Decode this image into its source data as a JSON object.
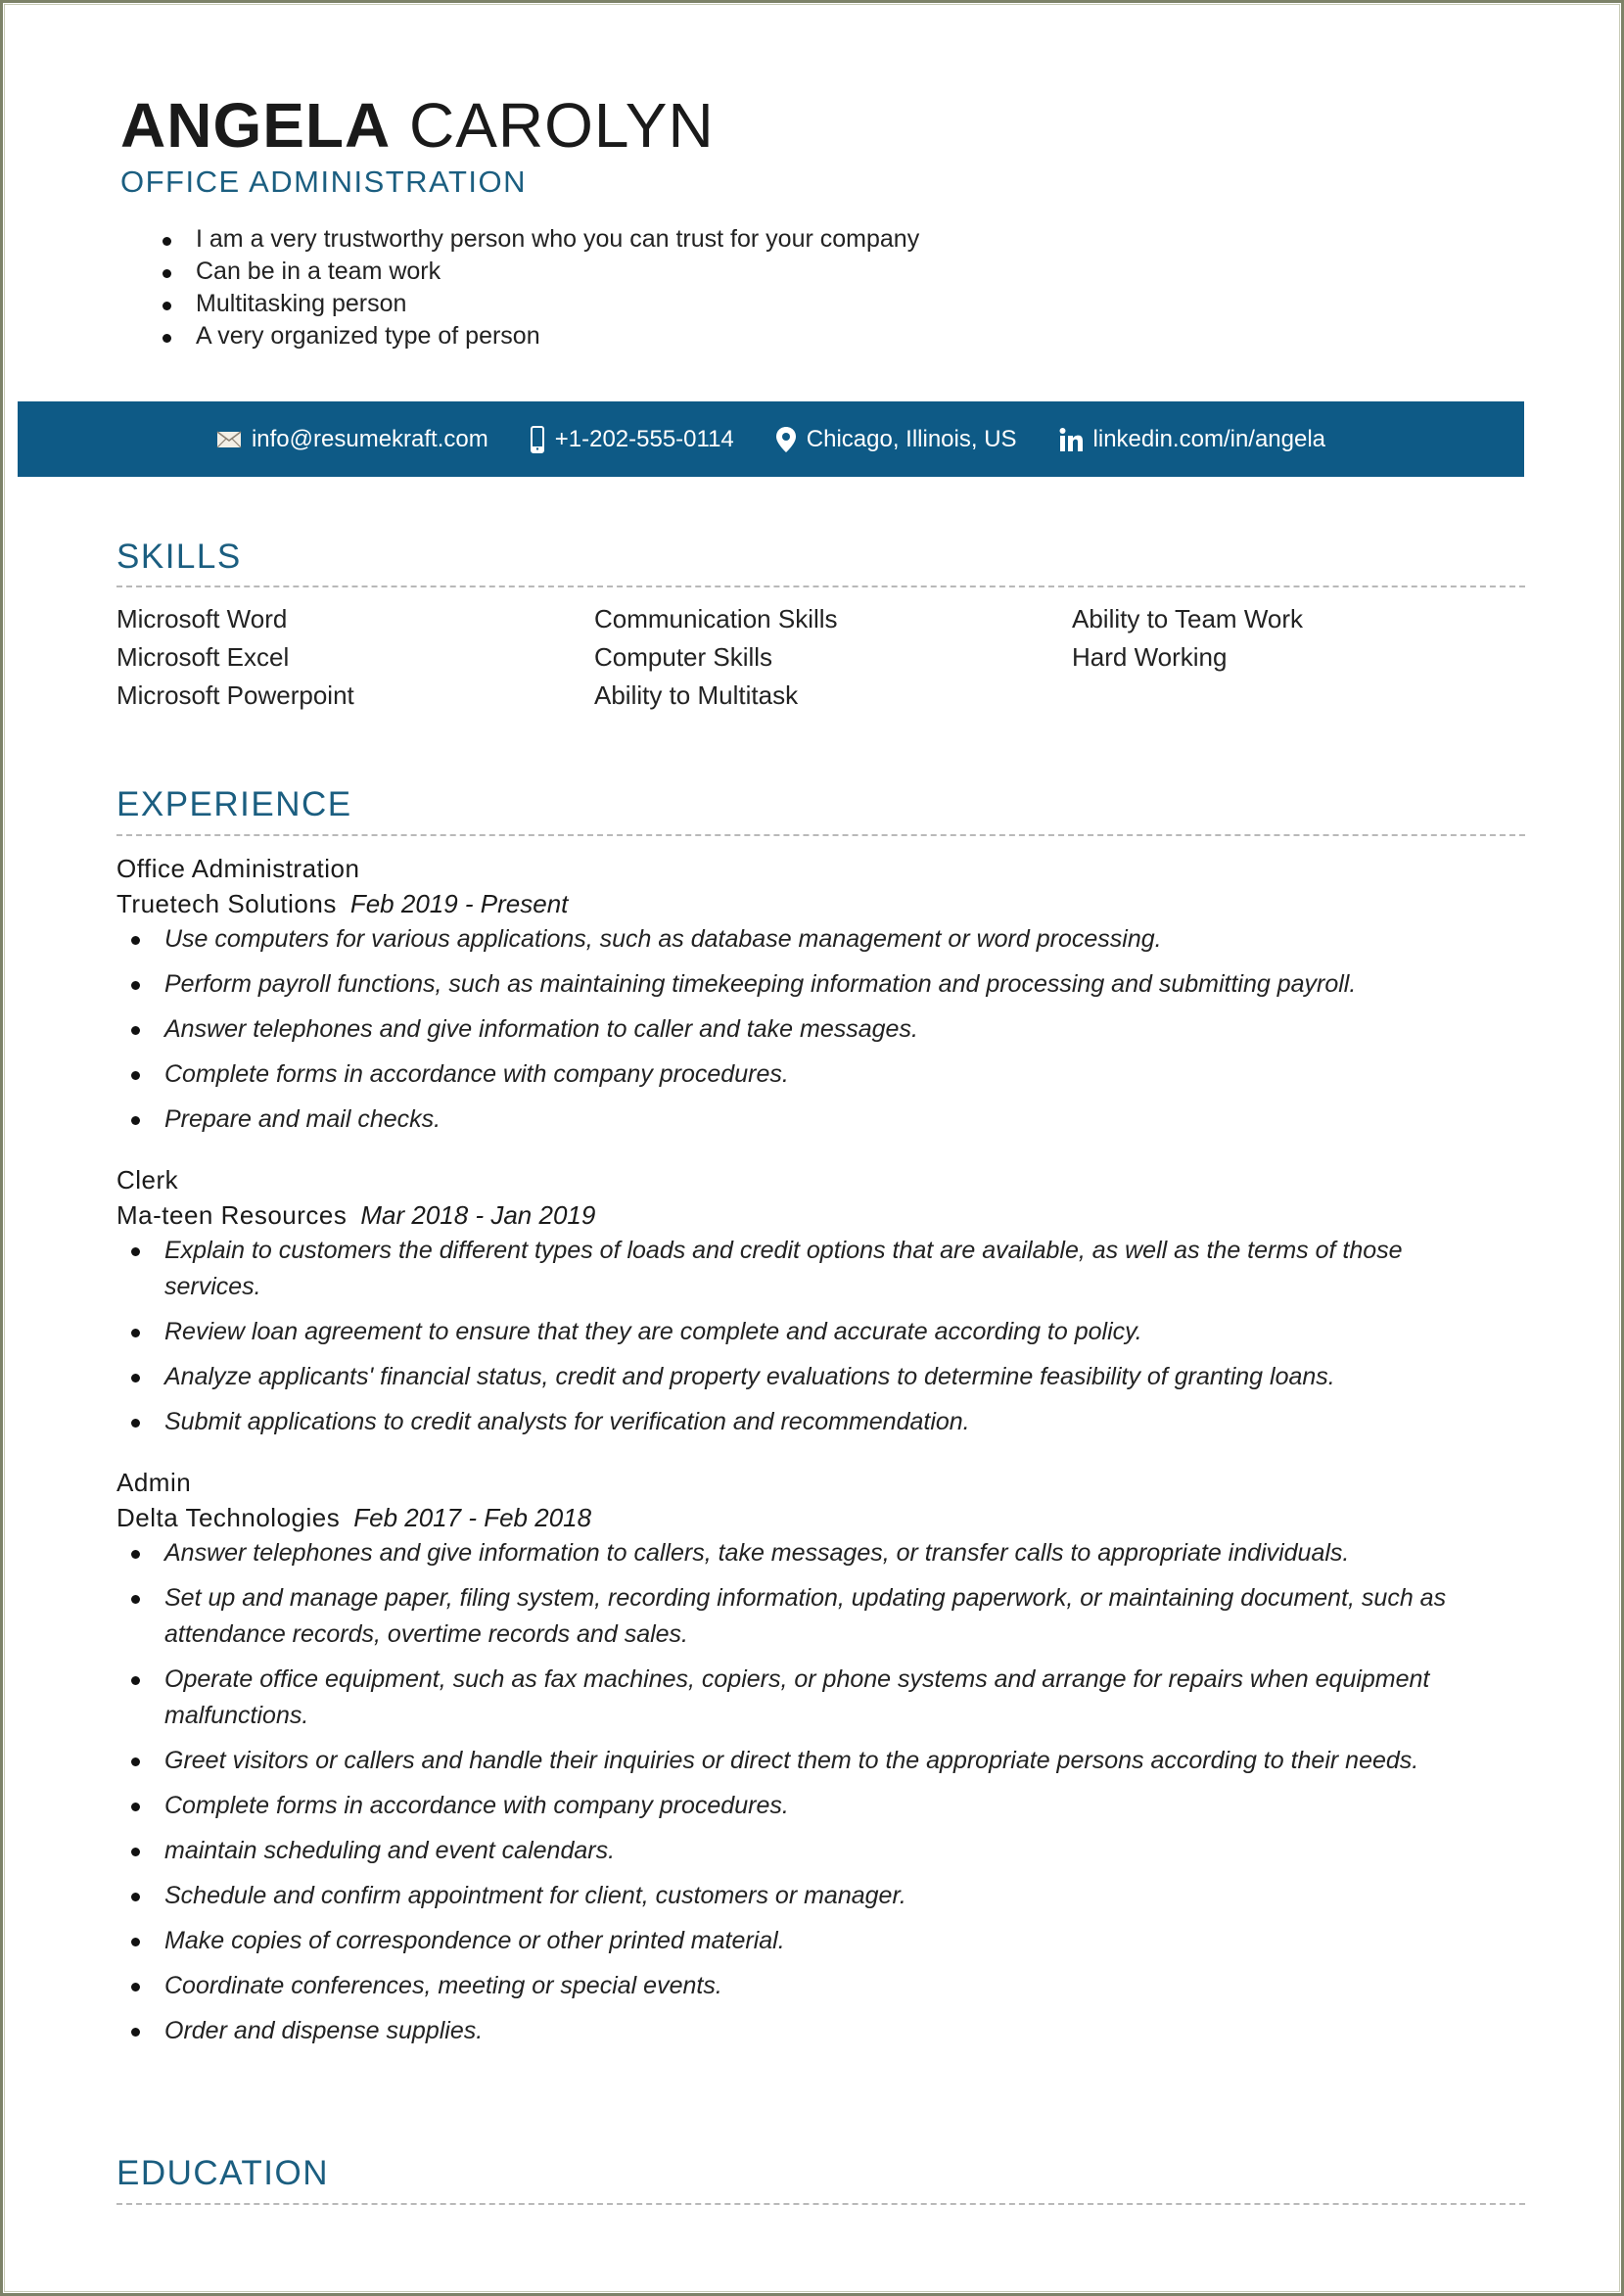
{
  "header": {
    "first_name": "ANGELA",
    "last_name": "CAROLYN",
    "title": "OFFICE ADMINISTRATION",
    "summary": [
      "I am a very trustworthy person who you can trust for your company",
      "Can be in a team work",
      "Multitasking person",
      "A very organized type of person"
    ]
  },
  "contact": {
    "email": {
      "icon": "envelope-icon",
      "text": "info@resumekraft.com"
    },
    "phone": {
      "icon": "mobile-phone-icon",
      "text": "+1-202-555-0114"
    },
    "location": {
      "icon": "map-pin-icon",
      "text": "Chicago, Illinois, US"
    },
    "linkedin": {
      "icon": "linkedin-icon",
      "text": "linkedin.com/in/angela"
    }
  },
  "colors": {
    "accent": "#1b5e80",
    "contact_bar": "#0e5a86"
  },
  "skills": {
    "title": "SKILLS",
    "items": [
      "Microsoft Word",
      "Communication Skills",
      "Ability to Team Work",
      "Microsoft Excel",
      "Computer Skills",
      "Hard Working",
      "Microsoft Powerpoint",
      "Ability to Multitask",
      ""
    ]
  },
  "experience": {
    "title": "EXPERIENCE",
    "jobs": [
      {
        "role": "Office Administration",
        "company": "Truetech Solutions",
        "dates": "Feb 2019 - Present",
        "bullets": [
          "Use computers for various applications, such as database management or word processing.",
          "Perform payroll functions, such as maintaining timekeeping information and processing and submitting payroll.",
          "Answer telephones and give information to caller and take messages.",
          "Complete forms in accordance with company procedures.",
          "Prepare and mail checks."
        ]
      },
      {
        "role": "Clerk",
        "company": "Ma-teen Resources",
        "dates": "Mar 2018 - Jan 2019",
        "bullets": [
          "Explain to customers the different types of loads and credit options that are available, as well as the terms of those services.",
          "Review loan agreement to ensure that they are complete and accurate according to policy.",
          "Analyze applicants' financial status, credit and property evaluations to determine feasibility of granting loans.",
          "Submit applications to credit analysts for verification and recommendation."
        ]
      },
      {
        "role": "Admin",
        "company": "Delta Technologies",
        "dates": "Feb 2017 - Feb 2018",
        "bullets": [
          "Answer telephones and give information to callers, take messages, or transfer calls to appropriate individuals.",
          "Set up and manage paper, filing system, recording information, updating paperwork, or maintaining document, such as attendance records, overtime records and sales.",
          "Operate office equipment, such as fax machines, copiers, or phone systems and arrange for repairs when equipment malfunctions.",
          "Greet visitors or callers and handle their inquiries or direct them to the appropriate persons according to their needs.",
          "Complete forms in accordance with company procedures.",
          "maintain scheduling and event calendars.",
          "Schedule and confirm appointment for client, customers or manager.",
          "Make copies of correspondence or other printed material.",
          "Coordinate conferences, meeting or special events.",
          "Order and dispense supplies."
        ]
      }
    ]
  },
  "education": {
    "title": "EDUCATION"
  }
}
